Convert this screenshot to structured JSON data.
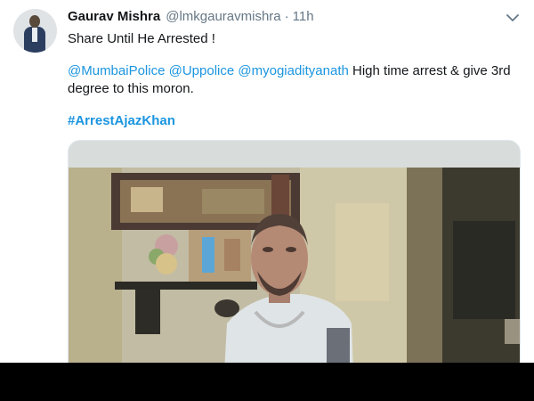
{
  "tweet": {
    "author_name": "Gaurav Mishra",
    "handle": "@lmkgauravmishra",
    "separator": "·",
    "time": "11h",
    "text_line1": "Share Until He Arrested !",
    "mentions": [
      "@MumbaiPolice",
      "@Uppolice",
      "@myogiadityanath"
    ],
    "text_line2_rest": "High time arrest & give 3rd",
    "text_line3": "degree to this moron.",
    "hashtag": "#ArrestAjazKhan"
  },
  "icons": {
    "caret": "chevron-down-icon"
  },
  "colors": {
    "link": "#1b95e0",
    "text": "#14171a",
    "muted": "#657786"
  }
}
